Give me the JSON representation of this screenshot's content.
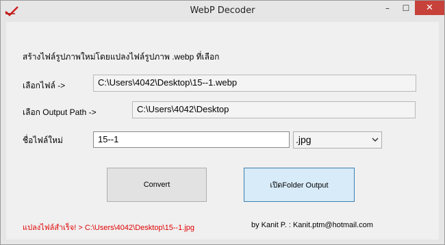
{
  "window": {
    "title": "WebP Decoder",
    "icon": "red-checkmark-icon",
    "controls": {
      "minimize": "–",
      "maximize": "☐",
      "close": "✕"
    },
    "close_color": "#c7423a"
  },
  "form": {
    "heading": "สร้างไฟล์รูปภาพใหม่โดยแปลงไฟล์รูปภาพ .webp ที่เลือก",
    "file_label": "เลือกไฟล์ ->",
    "file_value": "C:\\Users\\4042\\Desktop\\15--1.webp",
    "output_label": "เลือก Output Path ->",
    "output_value": "C:\\Users\\4042\\Desktop",
    "newname_label": "ชื่อไฟล์ใหม่",
    "newname_value": "15--1",
    "format_selected": ".jpg"
  },
  "buttons": {
    "convert": "Convert",
    "open_folder": "เปิดFolder Output"
  },
  "footer": {
    "status": "แปลงไฟล์สำเร็จ! > C:\\Users\\4042\\Desktop\\15--1.jpg",
    "status_color": "#e00000",
    "credit": "by Kanit P. : Kanit.ptm@hotmail.com"
  }
}
